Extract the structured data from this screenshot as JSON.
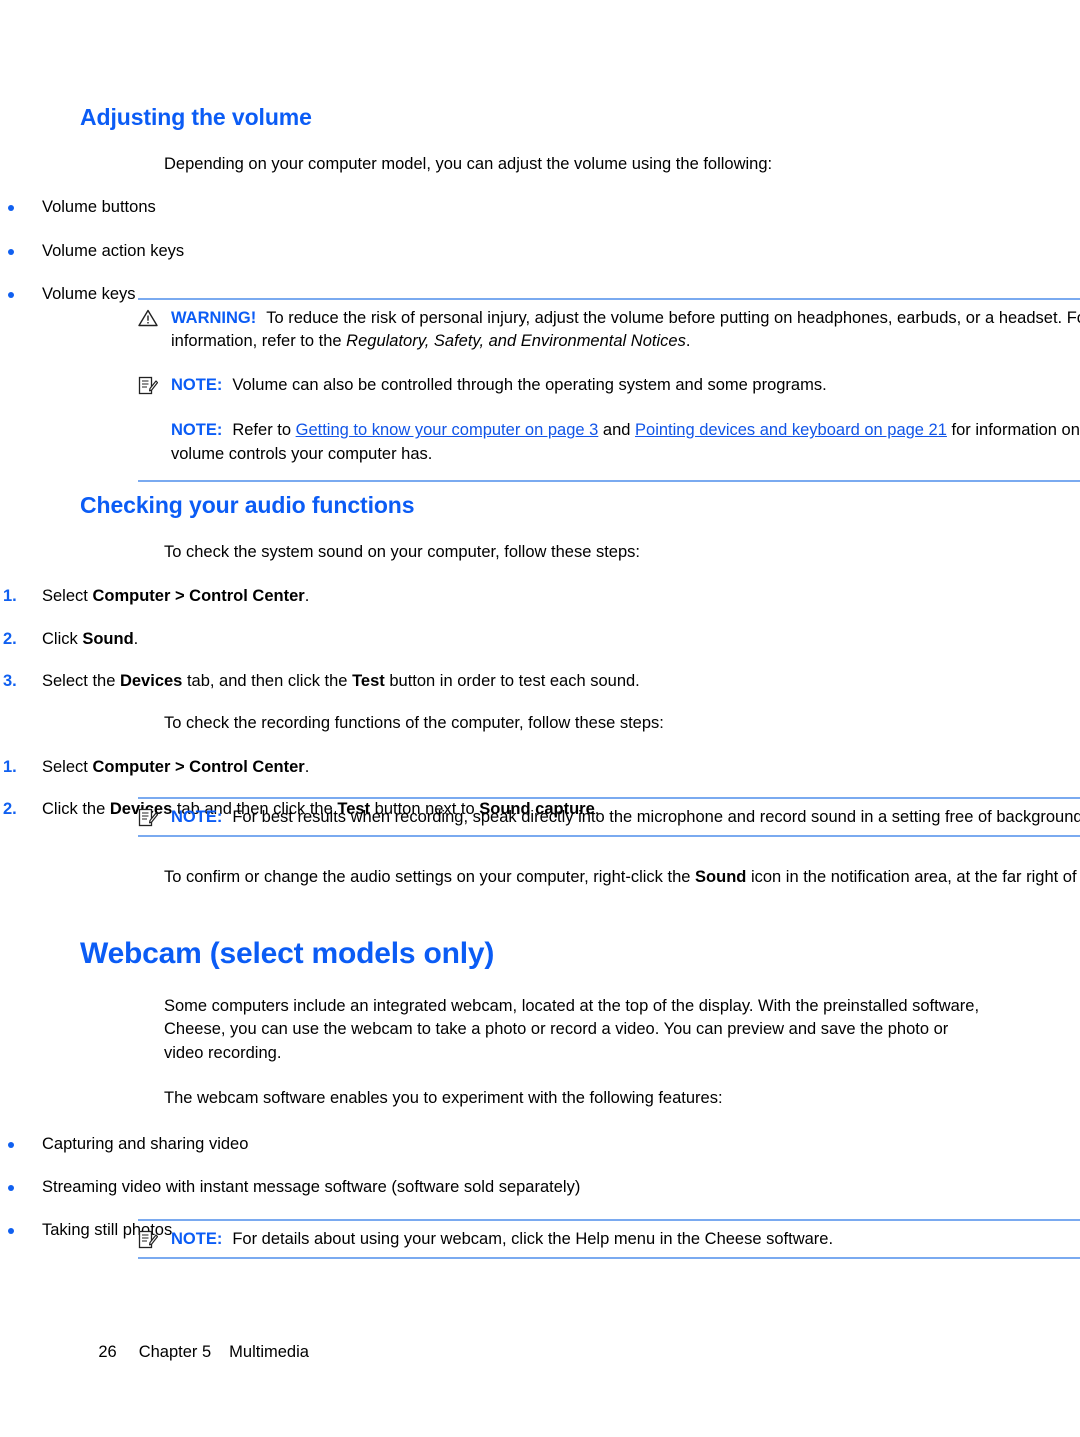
{
  "section_volume": {
    "heading": "Adjusting the volume",
    "intro": "Depending on your computer model, you can adjust the volume using the following:",
    "bullets": [
      "Volume buttons",
      "Volume action keys",
      "Volume keys"
    ]
  },
  "admonitions_volume": {
    "warning": {
      "icon": "warning-triangle-icon",
      "label": "WARNING!",
      "text_1": "To reduce the risk of personal injury, adjust the volume before putting on headphones, earbuds, or a headset. For additional safety information, refer to the ",
      "italic": "Regulatory, Safety, and Environmental Notices",
      "text_2": "."
    },
    "note_1": {
      "icon": "note-pencil-icon",
      "label": "NOTE:",
      "text": "Volume can also be controlled through the operating system and some programs."
    },
    "note_2": {
      "label": "NOTE:",
      "text_1": "Refer to ",
      "link_1": "Getting to know your computer on page 3",
      "text_2": " and ",
      "link_2": "Pointing devices and keyboard on page 21",
      "text_3": " for information on what type of volume controls your computer has."
    }
  },
  "section_audio": {
    "heading": "Checking your audio functions",
    "intro": "To check the system sound on your computer, follow these steps:",
    "steps": [
      {
        "num": "1.",
        "parts": [
          {
            "t": "Select ",
            "b": false
          },
          {
            "t": "Computer > Control Center",
            "b": true
          },
          {
            "t": ".",
            "b": false
          }
        ]
      },
      {
        "num": "2.",
        "parts": [
          {
            "t": "Click ",
            "b": false
          },
          {
            "t": "Sound",
            "b": true
          },
          {
            "t": ".",
            "b": false
          }
        ]
      },
      {
        "num": "3.",
        "parts": [
          {
            "t": "Select the ",
            "b": false
          },
          {
            "t": "Devices",
            "b": true
          },
          {
            "t": " tab, and then click the ",
            "b": false
          },
          {
            "t": "Test",
            "b": true
          },
          {
            "t": " button in order to test each sound.",
            "b": false
          }
        ]
      }
    ],
    "intro_recording": "To check the recording functions of the computer, follow these steps:",
    "steps_recording": [
      {
        "num": "1.",
        "parts": [
          {
            "t": "Select ",
            "b": false
          },
          {
            "t": "Computer > Control Center",
            "b": true
          },
          {
            "t": ".",
            "b": false
          }
        ]
      },
      {
        "num": "2.",
        "parts": [
          {
            "t": "Click the ",
            "b": false
          },
          {
            "t": "Devices",
            "b": true
          },
          {
            "t": " tab and then click the ",
            "b": false
          },
          {
            "t": "Test",
            "b": true
          },
          {
            "t": " button next to ",
            "b": false
          },
          {
            "t": "Sound capture",
            "b": true
          },
          {
            "t": ".",
            "b": false
          }
        ]
      }
    ],
    "note_recording": {
      "icon": "note-pencil-icon",
      "label": "NOTE:",
      "text": "For best results when recording, speak directly into the microphone and record sound in a setting free of background noise."
    },
    "closing_parts": [
      {
        "t": "To confirm or change the audio settings on your computer, right-click the ",
        "b": false
      },
      {
        "t": "Sound",
        "b": true
      },
      {
        "t": " icon in the notification area, at the far right of the taskbar.",
        "b": false
      }
    ]
  },
  "section_webcam": {
    "heading": "Webcam (select models only)",
    "para_1": "Some computers include an integrated webcam, located at the top of the display. With the preinstalled software, Cheese, you can use the webcam to take a photo or record a video. You can preview and save the photo or video recording.",
    "para_2": "The webcam software enables you to experiment with the following features:",
    "bullets": [
      "Capturing and sharing video",
      "Streaming video with instant message software (software sold separately)",
      "Taking still photos"
    ],
    "note": {
      "icon": "note-pencil-icon",
      "label": "NOTE:",
      "text": "For details about using your webcam, click the Help menu in the Cheese software."
    }
  },
  "footer": {
    "page_number": "26",
    "chapter": "Chapter 5",
    "chapter_title": "Multimedia"
  },
  "colors": {
    "heading_blue": "#0b5cf5",
    "rule_blue": "#7aaaf0",
    "link_blue": "#1155e8",
    "bullet_blue": "#1060f0"
  }
}
